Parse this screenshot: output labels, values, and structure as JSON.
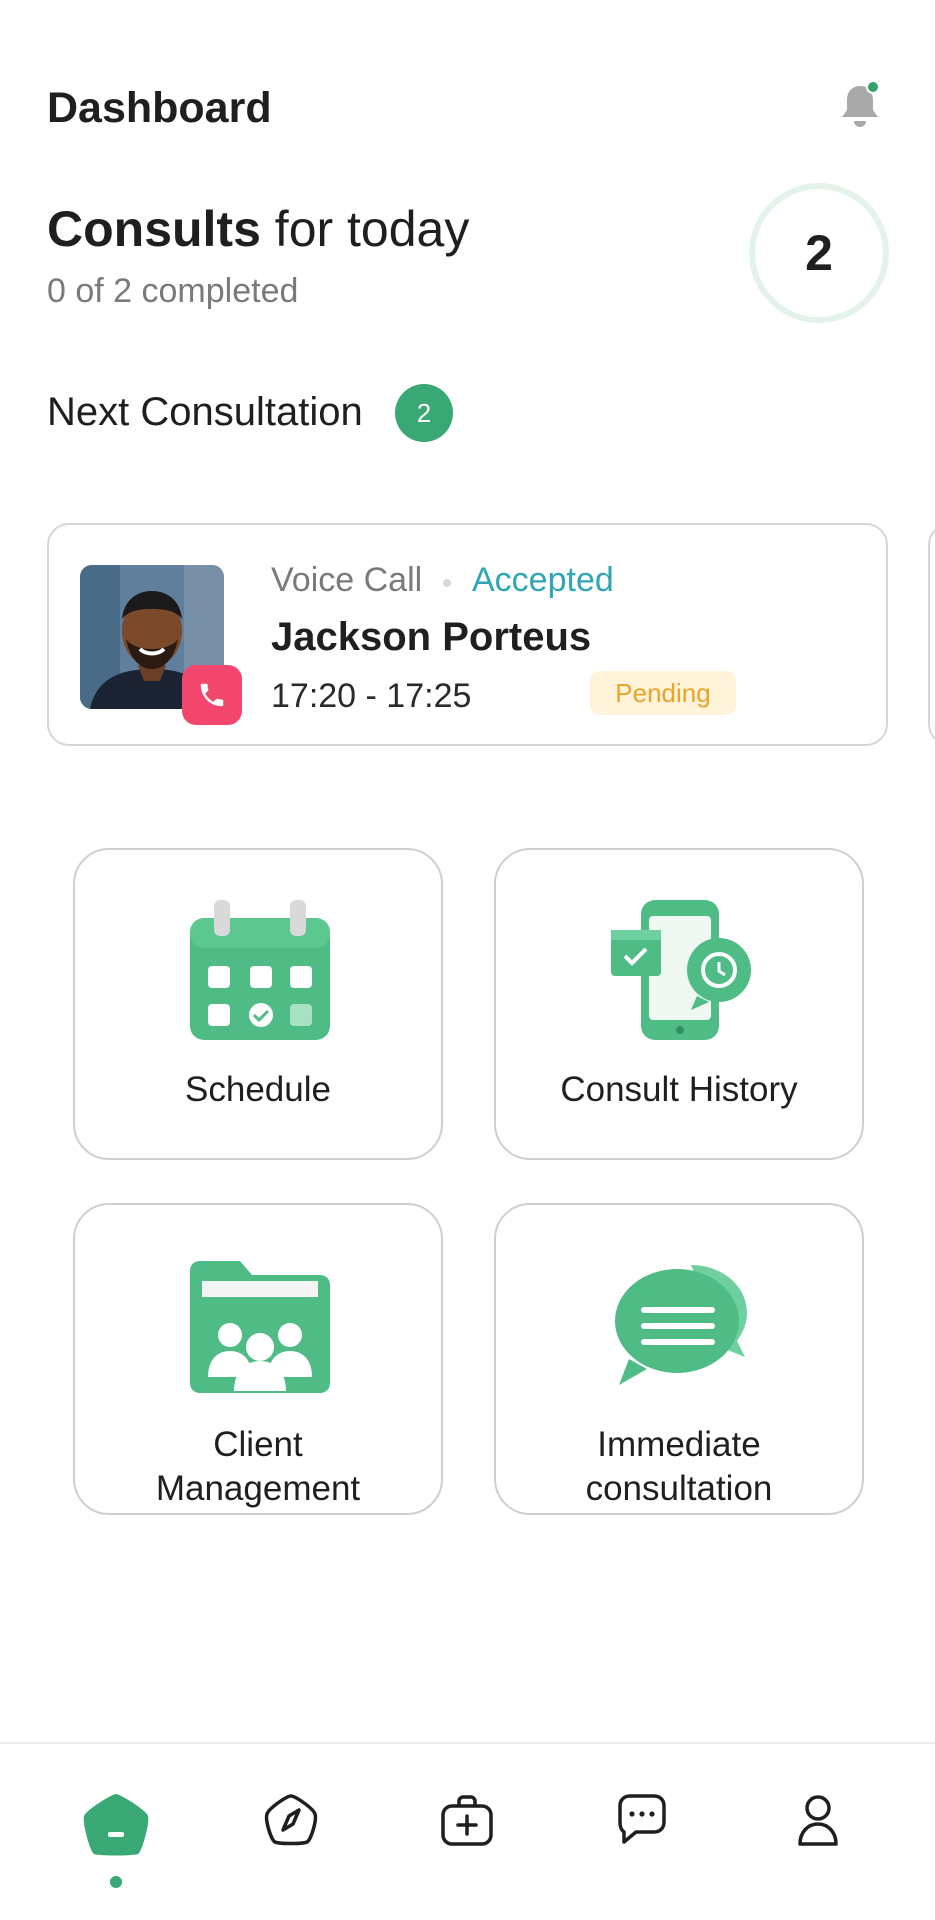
{
  "header": {
    "title": "Dashboard",
    "bell_icon": "bell-icon",
    "has_notification": true
  },
  "consults": {
    "title_bold": "Consults",
    "title_rest": " for today",
    "subtitle": "0 of 2 completed",
    "count": "2"
  },
  "next_consultation": {
    "title": "Next Consultation",
    "badge": "2"
  },
  "consult_card": {
    "call_type": "Voice Call",
    "status": "Accepted",
    "patient_name": "Jackson Porteus",
    "time_range": "17:20 - 17:25",
    "badge": "Pending",
    "call_icon": "phone-icon"
  },
  "tiles": [
    {
      "label": "Schedule",
      "icon": "calendar-icon"
    },
    {
      "label": "Consult History",
      "icon": "history-icon"
    },
    {
      "label": "Client\nManagement",
      "icon": "client-folder-icon"
    },
    {
      "label": "Immediate\nconsultation",
      "icon": "chat-bubbles-icon"
    }
  ],
  "bottom_nav": [
    {
      "name": "home",
      "icon": "home-icon",
      "active": true
    },
    {
      "name": "explore",
      "icon": "compass-icon",
      "active": false
    },
    {
      "name": "health",
      "icon": "medical-kit-icon",
      "active": false
    },
    {
      "name": "messages",
      "icon": "message-icon",
      "active": false
    },
    {
      "name": "profile",
      "icon": "profile-icon",
      "active": false
    }
  ],
  "colors": {
    "accent": "#3aa874",
    "accepted": "#2fa6b6",
    "pending_text": "#e9a42a",
    "pending_bg": "#fff3d9",
    "call_badge": "#f2466d"
  }
}
